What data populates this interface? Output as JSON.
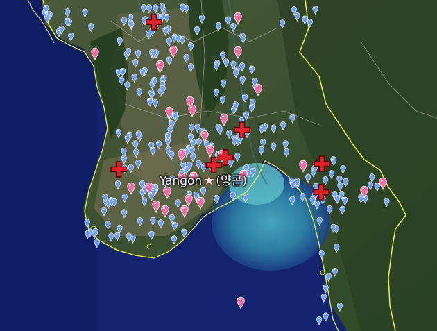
{
  "map": {
    "city": {
      "name": "Yangon",
      "native_name": "(양곤)",
      "marker": "star-icon"
    },
    "colors": {
      "sea": "#10206a",
      "land": "#2f4a26",
      "coast_border": "#e8f24a",
      "pin_blue": "#6e9cf0",
      "pin_pink": "#f46aa4",
      "red_cross": "#e0242c"
    },
    "marker_types": [
      "blue-pin-icon",
      "pink-pin-icon",
      "red-cross-icon"
    ]
  }
}
